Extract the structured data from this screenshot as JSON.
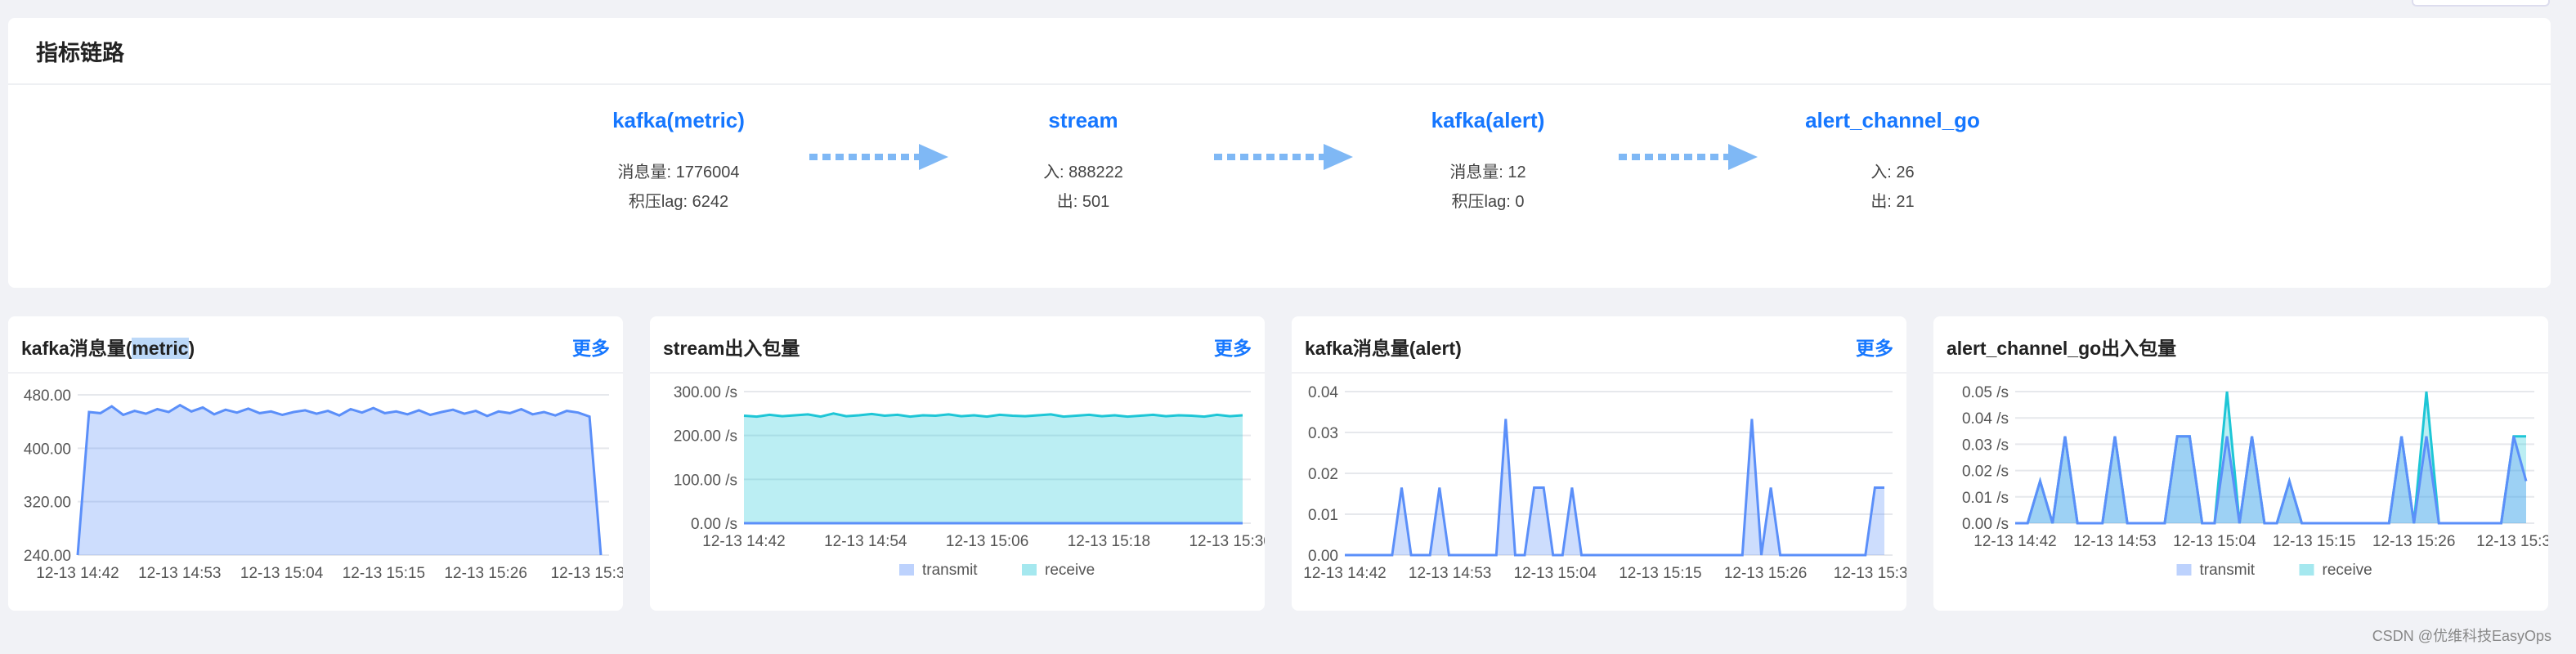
{
  "section": {
    "title": "指标链路"
  },
  "pipeline": [
    {
      "name": "kafka(metric)",
      "stat1": "消息量: 1776004",
      "stat2": "积压lag: 6242"
    },
    {
      "name": "stream",
      "stat1": "入: 888222",
      "stat2": "出: 501"
    },
    {
      "name": "kafka(alert)",
      "stat1": "消息量: 12",
      "stat2": "积压lag: 0"
    },
    {
      "name": "alert_channel_go",
      "stat1": "入: 26",
      "stat2": "出: 21"
    }
  ],
  "cards": [
    {
      "title_a": "kafka消息量(",
      "title_hl": "metric",
      "title_b": ")",
      "more": "更多"
    },
    {
      "title": "stream出入包量",
      "more": "更多"
    },
    {
      "title": "kafka消息量(alert)",
      "more": "更多"
    },
    {
      "title": "alert_channel_go出入包量"
    }
  ],
  "watermark": "CSDN @优维科技EasyOps",
  "colors": {
    "link": "#1677ff",
    "blue_series": "#5b8ff9",
    "cyan_series": "#1ec6d6"
  },
  "chart_data": [
    {
      "type": "area",
      "x_ticks": [
        "12-13 14:42",
        "12-13 14:53",
        "12-13 15:04",
        "12-13 15:15",
        "12-13 15:26",
        "12-13 15:3"
      ],
      "y_ticks": [
        "480.00",
        "400.00",
        "320.00",
        "240.00"
      ],
      "ylim": [
        240,
        520
      ],
      "series": [
        {
          "color": "#5b8ff9",
          "values": [
            240,
            490,
            488,
            500,
            485,
            492,
            487,
            495,
            490,
            502,
            491,
            498,
            486,
            494,
            489,
            496,
            488,
            491,
            485,
            490,
            493,
            487,
            492,
            484,
            495,
            489,
            497,
            488,
            491,
            486,
            493,
            485,
            490,
            494,
            487,
            492,
            483,
            491,
            488,
            495,
            486,
            490,
            484,
            492,
            489,
            482,
            240
          ]
        }
      ]
    },
    {
      "type": "area",
      "x_ticks": [
        "12-13 14:42",
        "12-13 14:54",
        "12-13 15:06",
        "12-13 15:18",
        "12-13 15:30"
      ],
      "y_ticks": [
        "300.00 /s",
        "200.00 /s",
        "100.00 /s",
        "0.00 /s"
      ],
      "ylim": [
        0,
        300
      ],
      "legend": [
        "transmit",
        "receive"
      ],
      "series": [
        {
          "name": "transmit",
          "color": "#5b8ff9",
          "values": [
            0,
            0,
            0,
            0,
            0,
            0,
            0,
            0,
            0,
            0,
            0,
            0,
            0,
            0,
            0,
            0,
            0,
            0,
            0,
            0,
            0,
            0,
            0,
            0,
            0,
            0,
            0,
            0,
            0,
            0,
            0,
            0,
            0,
            0,
            0,
            0,
            0,
            0,
            0,
            0
          ]
        },
        {
          "name": "receive",
          "color": "#1ec6d6",
          "values": [
            245,
            243,
            247,
            244,
            246,
            248,
            243,
            250,
            244,
            246,
            249,
            245,
            247,
            243,
            246,
            245,
            248,
            244,
            246,
            243,
            247,
            245,
            244,
            246,
            248,
            243,
            245,
            247,
            244,
            246,
            243,
            245,
            247,
            244,
            246,
            245,
            243,
            247,
            244,
            246
          ]
        }
      ]
    },
    {
      "type": "area",
      "x_ticks": [
        "12-13 14:42",
        "12-13 14:53",
        "12-13 15:04",
        "12-13 15:15",
        "12-13 15:26",
        "12-13 15:3"
      ],
      "y_ticks": [
        "0.04",
        "0.03",
        "0.02",
        "0.01",
        "0.00"
      ],
      "ylim": [
        0,
        0.04
      ],
      "series": [
        {
          "color": "#5b8ff9",
          "values": [
            0,
            0,
            0,
            0,
            0,
            0,
            0.0165,
            0,
            0,
            0,
            0.0165,
            0,
            0,
            0,
            0,
            0,
            0,
            0.0333,
            0,
            0,
            0.0165,
            0.0165,
            0,
            0,
            0.0165,
            0,
            0,
            0,
            0,
            0,
            0,
            0,
            0,
            0,
            0,
            0,
            0,
            0,
            0,
            0,
            0,
            0,
            0,
            0.0333,
            0,
            0.0165,
            0,
            0,
            0,
            0,
            0,
            0,
            0,
            0,
            0,
            0,
            0.0165,
            0.0165
          ]
        }
      ]
    },
    {
      "type": "area",
      "x_ticks": [
        "12-13 14:42",
        "12-13 14:53",
        "12-13 15:04",
        "12-13 15:15",
        "12-13 15:26",
        "12-13 15:3"
      ],
      "y_ticks": [
        "0.05 /s",
        "0.04 /s",
        "0.03 /s",
        "0.02 /s",
        "0.01 /s",
        "0.00 /s"
      ],
      "ylim": [
        0,
        0.05
      ],
      "legend": [
        "transmit",
        "receive"
      ],
      "series": [
        {
          "name": "transmit",
          "color": "#5b8ff9",
          "values": [
            0,
            0,
            0.016,
            0,
            0.033,
            0,
            0,
            0,
            0.033,
            0,
            0,
            0,
            0,
            0.033,
            0.033,
            0,
            0,
            0.033,
            0,
            0.033,
            0,
            0,
            0.016,
            0,
            0,
            0,
            0,
            0,
            0,
            0,
            0,
            0.033,
            0,
            0.033,
            0,
            0,
            0,
            0,
            0,
            0,
            0.033,
            0.016
          ]
        },
        {
          "name": "receive",
          "color": "#1ec6d6",
          "values": [
            0,
            0,
            0.016,
            0,
            0.033,
            0,
            0,
            0,
            0.033,
            0,
            0,
            0,
            0,
            0.033,
            0.033,
            0,
            0,
            0.05,
            0,
            0.033,
            0,
            0,
            0.016,
            0,
            0,
            0,
            0,
            0,
            0,
            0,
            0,
            0.033,
            0,
            0.05,
            0,
            0,
            0,
            0,
            0,
            0,
            0.033,
            0.033
          ]
        }
      ]
    }
  ]
}
